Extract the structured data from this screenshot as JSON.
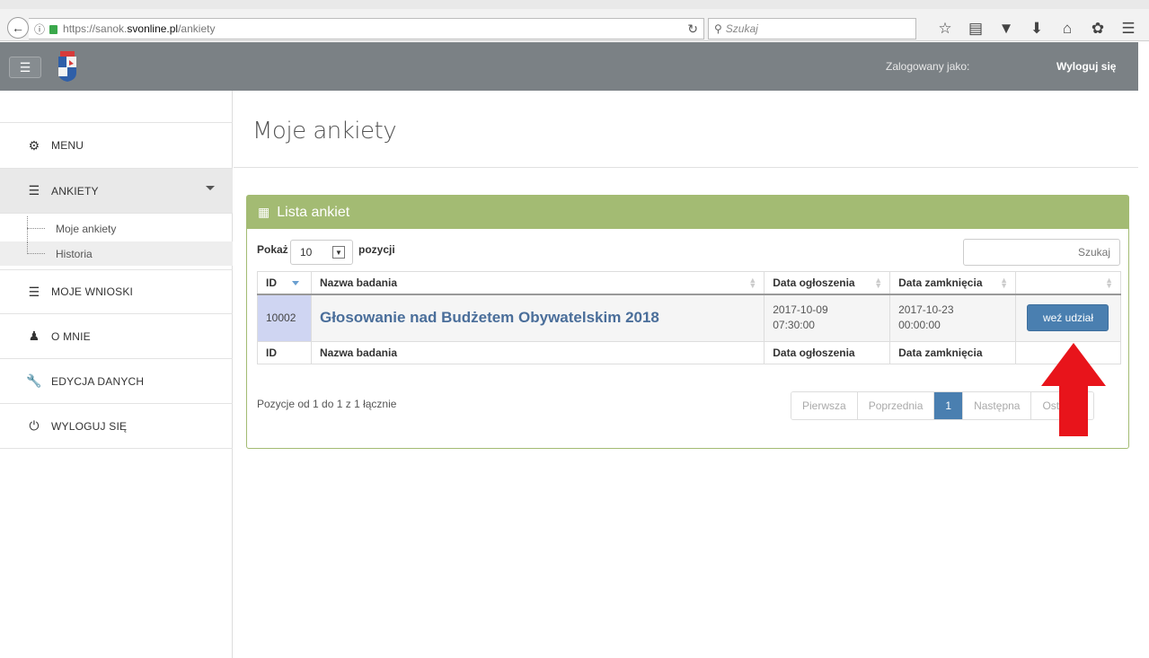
{
  "browser": {
    "url_prefix": "https://sanok.",
    "url_host": "svonline.pl",
    "url_path": "/ankiety",
    "search_placeholder": "Szukaj"
  },
  "header": {
    "logged_as": "Zalogowany jako:",
    "logout": "Wyloguj się"
  },
  "sidebar": {
    "items": [
      {
        "label": "MENU",
        "icon": "dashboard-icon"
      },
      {
        "label": "ANKIETY",
        "icon": "list-icon"
      },
      {
        "label": "MOJE WNIOSKI",
        "icon": "list-icon"
      },
      {
        "label": "O MNIE",
        "icon": "user-icon"
      },
      {
        "label": "EDYCJA DANYCH",
        "icon": "wrench-icon"
      },
      {
        "label": "WYLOGUJ SIĘ",
        "icon": "power-icon"
      }
    ],
    "sub_items": [
      {
        "label": "Moje ankiety"
      },
      {
        "label": "Historia"
      }
    ]
  },
  "page": {
    "title": "Moje ankiety"
  },
  "panel": {
    "title": "Lista ankiet",
    "show_label": "Pokaż",
    "page_size": "10",
    "positions_label": "pozycji",
    "search_placeholder": "Szukaj",
    "columns": [
      "ID",
      "Nazwa badania",
      "Data ogłoszenia",
      "Data zamknięcia",
      ""
    ],
    "rows": [
      {
        "id": "10002",
        "name": "Głosowanie nad Budżetem Obywatelskim 2018",
        "announce_date": "2017-10-09",
        "announce_time": "07:30:00",
        "close_date": "2017-10-23",
        "close_time": "00:00:00",
        "action": "weź udział"
      }
    ],
    "info": "Pozycje od 1 do 1 z 1 łącznie",
    "pagination": {
      "first": "Pierwsza",
      "prev": "Poprzednia",
      "current": "1",
      "next": "Następna",
      "last": "Ostatnia"
    }
  },
  "colors": {
    "header_bg": "#7b8185",
    "panel_accent": "#a3bb73",
    "button_blue": "#4a7fb0",
    "arrow_red": "#e8141b"
  }
}
